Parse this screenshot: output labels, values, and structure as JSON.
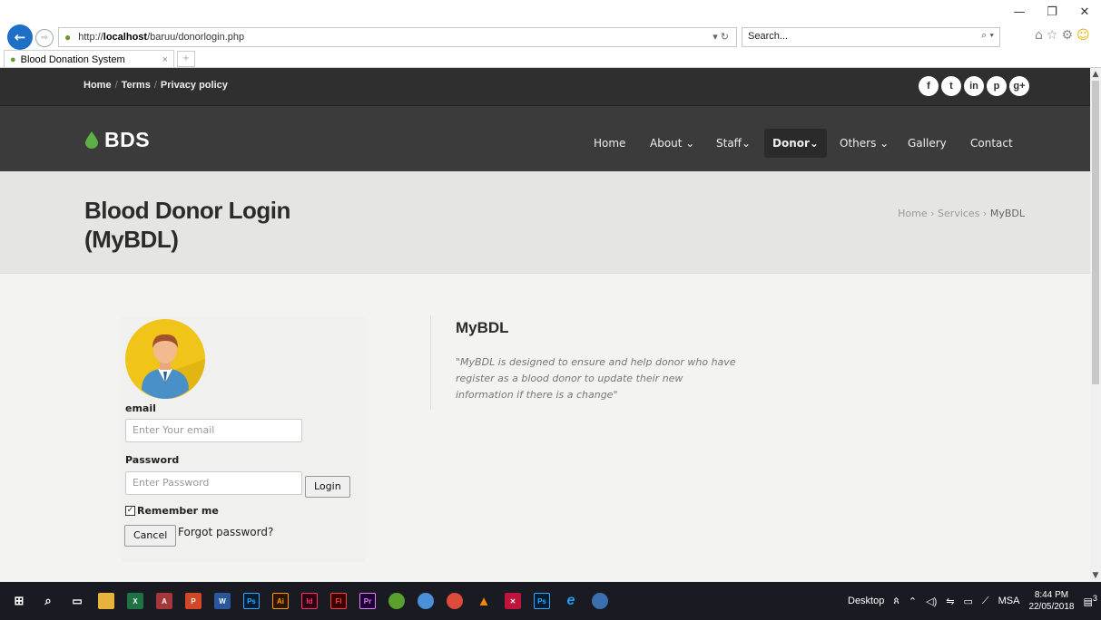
{
  "browser": {
    "url_prefix": "http://",
    "url_host": "localhost",
    "url_path": "/baruu/donorlogin.php",
    "search_placeholder": "Search...",
    "tab_title": "Blood Donation System",
    "win_min": "—",
    "win_restore": "❐",
    "win_close": "✕"
  },
  "topbar": {
    "links": [
      "Home",
      "Terms",
      "Privacy policy"
    ],
    "social": [
      "f",
      "t",
      "in",
      "p",
      "g+"
    ]
  },
  "logo": {
    "text": "BDS",
    "color": "#5db045"
  },
  "nav": {
    "items": [
      {
        "label": "Home"
      },
      {
        "label": "About ⌄"
      },
      {
        "label": "Staff⌄"
      },
      {
        "label": "Donor⌄"
      },
      {
        "label": "Others ⌄"
      },
      {
        "label": "Gallery"
      },
      {
        "label": "Contact"
      }
    ],
    "active": "Donor"
  },
  "hero": {
    "title_line1": "Blood Donor Login",
    "title_line2": "(MyBDL)",
    "breadcrumb": [
      "Home",
      "Services",
      "MyBDL"
    ]
  },
  "login": {
    "email_label": "email",
    "email_placeholder": "Enter Your email",
    "password_label": "Password",
    "password_placeholder": "Enter Password",
    "login_button": "Login",
    "remember_label": "Remember me",
    "remember_checked": true,
    "cancel_button": "Cancel",
    "forgot_label": "Forgot password?"
  },
  "info": {
    "title": "MyBDL",
    "description": "\"MyBDL is designed to ensure and help donor who have register as a blood donor to update their new information if there is a change\""
  },
  "taskbar": {
    "desktop_label": "Desktop",
    "lang": "MSA",
    "time": "8:44 PM",
    "date": "22/05/2018",
    "notification_count": "3"
  }
}
